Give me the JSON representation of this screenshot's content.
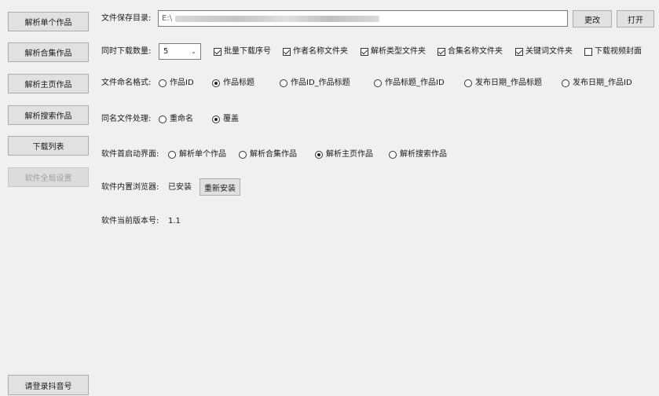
{
  "sidebar": {
    "items": [
      {
        "label": "解析单个作品"
      },
      {
        "label": "解析合集作品"
      },
      {
        "label": "解析主页作品"
      },
      {
        "label": "解析搜索作品"
      },
      {
        "label": "下载列表"
      },
      {
        "label": "软件全局设置",
        "disabled": true
      }
    ],
    "login_label": "请登录抖音号"
  },
  "save_dir": {
    "label": "文件保存目录:",
    "value": "E:\\",
    "change_button": "更改",
    "open_button": "打开"
  },
  "concurrent": {
    "label": "同时下载数量:",
    "value": "5"
  },
  "checkboxes": [
    {
      "label": "批量下载序号",
      "checked": true
    },
    {
      "label": "作者名称文件夹",
      "checked": true
    },
    {
      "label": "解析类型文件夹",
      "checked": true
    },
    {
      "label": "合集名称文件夹",
      "checked": true
    },
    {
      "label": "关键词文件夹",
      "checked": true
    },
    {
      "label": "下载视频封面",
      "checked": false
    }
  ],
  "naming": {
    "label": "文件命名格式:",
    "options": [
      {
        "label": "作品ID",
        "checked": false
      },
      {
        "label": "作品标题",
        "checked": true
      },
      {
        "label": "作品ID_作品标题",
        "checked": false
      },
      {
        "label": "作品标题_作品ID",
        "checked": false
      },
      {
        "label": "发布日期_作品标题",
        "checked": false
      },
      {
        "label": "发布日期_作品ID",
        "checked": false
      }
    ]
  },
  "duplicate": {
    "label": "同名文件处理:",
    "options": [
      {
        "label": "重命名",
        "checked": false
      },
      {
        "label": "覆盖",
        "checked": true
      }
    ]
  },
  "startup": {
    "label": "软件首启动界面:",
    "options": [
      {
        "label": "解析单个作品",
        "checked": false
      },
      {
        "label": "解析合集作品",
        "checked": false
      },
      {
        "label": "解析主页作品",
        "checked": true
      },
      {
        "label": "解析搜索作品",
        "checked": false
      }
    ]
  },
  "browser": {
    "label": "软件内置浏览器:",
    "status": "已安装",
    "reinstall_button": "重新安装"
  },
  "version": {
    "label": "软件当前版本号:",
    "value": "1.1"
  }
}
